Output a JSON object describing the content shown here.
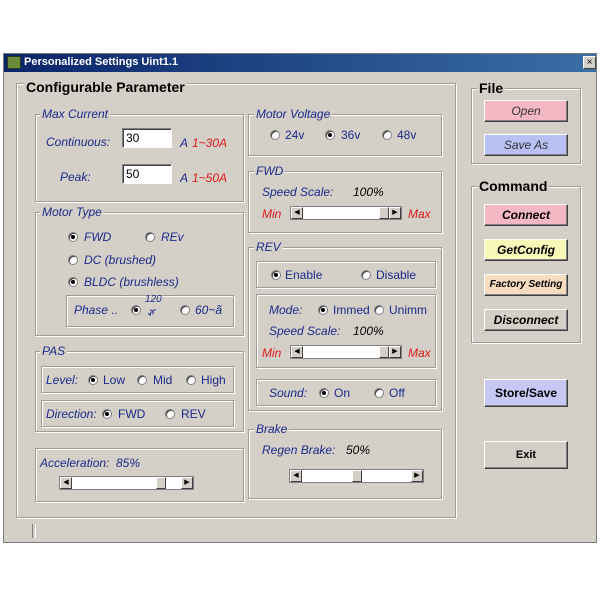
{
  "window": {
    "title": "Personalized Settings Uint1.1",
    "close": "×"
  },
  "config": {
    "header": "Configurable Parameter",
    "max_current": {
      "label": "Max Current",
      "continuous_label": "Continuous:",
      "continuous_value": "30",
      "peak_label": "Peak:",
      "peak_value": "50",
      "unit": "A",
      "continuous_range": "1~30A",
      "peak_range": "1~50A"
    },
    "motor_type": {
      "label": "Motor Type",
      "fwd": "FWD",
      "rev": "REv",
      "dc": "DC (brushed)",
      "bldc": "BLDC (brushless)",
      "phase_label": "Phase ..",
      "phase_120_top": "120",
      "phase_120_bot": "ⶦ",
      "phase_60": "60~ã"
    },
    "pas": {
      "label": "PAS",
      "level_label": "Level:",
      "low": "Low",
      "mid": "Mid",
      "high": "High",
      "direction_label": "Direction:",
      "fwd": "FWD",
      "rev": "REV"
    },
    "acceleration": {
      "label": "Acceleration:",
      "value": "85%",
      "level": 0.85
    },
    "motor_voltage": {
      "label": "Motor Voltage",
      "v24": "24v",
      "v36": "36v",
      "v48": "48v"
    },
    "fwd": {
      "label": "FWD",
      "speed_label": "Speed Scale:",
      "speed_value": "100%",
      "min": "Min",
      "max": "Max",
      "level": 1.0
    },
    "rev": {
      "label": "REV",
      "enable": "Enable",
      "disable": "Disable",
      "mode_label": "Mode:",
      "immed": "Immed",
      "unimm": "Unimm",
      "speed_label": "Speed Scale:",
      "speed_value": "100%",
      "min": "Min",
      "max": "Max",
      "sound_label": "Sound:",
      "on": "On",
      "off": "Off",
      "level": 1.0
    },
    "brake": {
      "label": "Brake",
      "regen_label": "Regen Brake:",
      "regen_value": "50%",
      "level": 0.5
    }
  },
  "file": {
    "header": "File",
    "open": "Open",
    "save_as": "Save As"
  },
  "command": {
    "header": "Command",
    "connect": "Connect",
    "get_config": "GetConfig",
    "factory": "Factory Setting",
    "disconnect": "Disconnect"
  },
  "actions": {
    "store": "Store/Save",
    "exit": "Exit"
  },
  "colors": {
    "open_btn": "#f4b8c4",
    "save_as_btn": "#b8c0f4",
    "connect_btn": "#f4b8c4",
    "getconfig_btn": "#f8f8b8",
    "factory_btn": "#f8dcc0",
    "store_btn": "#c8c8f4",
    "label_blue": "#1b2a8a",
    "range_red": "#e01818"
  }
}
